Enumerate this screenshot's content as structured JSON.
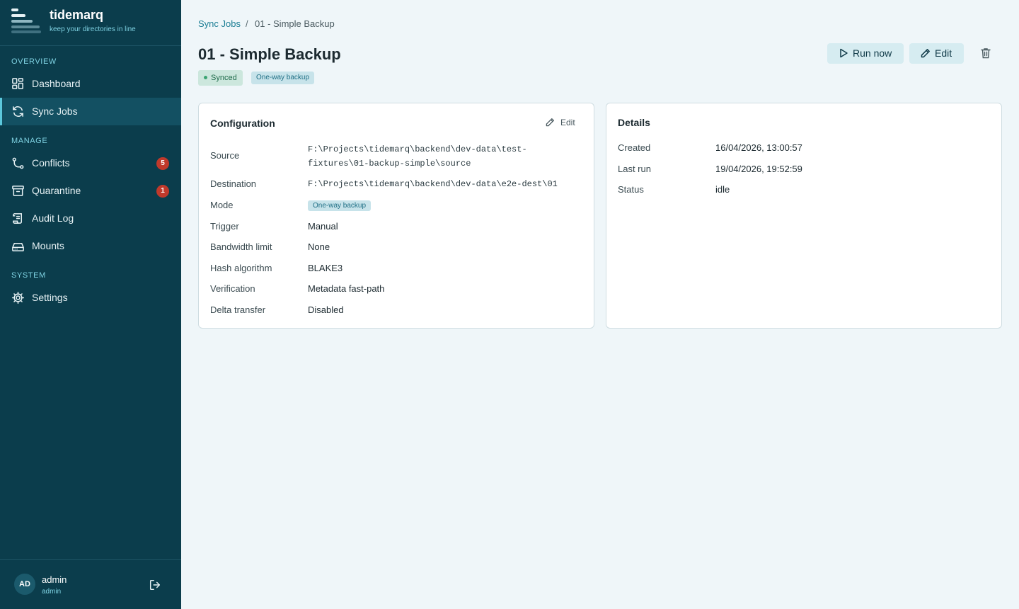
{
  "app": {
    "name": "tidemarq",
    "tagline": "keep your directories in line"
  },
  "sidebar": {
    "sections": {
      "overview": "OVERVIEW",
      "manage": "MANAGE",
      "system": "SYSTEM"
    },
    "items": [
      {
        "label": "Dashboard",
        "icon": "dashboard-icon"
      },
      {
        "label": "Sync Jobs",
        "icon": "sync-icon",
        "active": true
      },
      {
        "label": "Conflicts",
        "icon": "conflicts-icon",
        "badge": "5"
      },
      {
        "label": "Quarantine",
        "icon": "archive-icon",
        "badge": "1"
      },
      {
        "label": "Audit Log",
        "icon": "scroll-icon"
      },
      {
        "label": "Mounts",
        "icon": "drive-icon"
      },
      {
        "label": "Settings",
        "icon": "gear-icon"
      }
    ],
    "badge_color": "#c0392b"
  },
  "user": {
    "initials": "AD",
    "name": "admin",
    "role": "admin"
  },
  "breadcrumb": {
    "parent": "Sync Jobs",
    "separator": "/",
    "current": "01 - Simple Backup"
  },
  "page": {
    "title": "01 - Simple Backup",
    "status_tag": "Synced",
    "mode_tag": "One-way backup"
  },
  "actions": {
    "run_now": "Run now",
    "edit": "Edit"
  },
  "configuration": {
    "title": "Configuration",
    "edit_label": "Edit",
    "rows": [
      {
        "label": "Source",
        "value": "F:\\Projects\\tidemarq\\backend\\dev-data\\test-fixtures\\01-backup-simple\\source"
      },
      {
        "label": "Destination",
        "value": "F:\\Projects\\tidemarq\\backend\\dev-data\\e2e-dest\\01"
      },
      {
        "label": "Mode",
        "value": "One-way backup"
      },
      {
        "label": "Trigger",
        "value": "Manual"
      },
      {
        "label": "Bandwidth limit",
        "value": "None"
      },
      {
        "label": "Hash algorithm",
        "value": "BLAKE3"
      },
      {
        "label": "Verification",
        "value": "Metadata fast-path"
      },
      {
        "label": "Delta transfer",
        "value": "Disabled"
      }
    ]
  },
  "details": {
    "title": "Details",
    "rows": [
      {
        "label": "Created",
        "value": "16/04/2026, 13:00:57"
      },
      {
        "label": "Last run",
        "value": "19/04/2026, 19:52:59"
      },
      {
        "label": "Status",
        "value": "idle"
      }
    ]
  },
  "colors": {
    "sidebar_bg": "#0b3d4c",
    "accent": "#1a7d94",
    "page_bg": "#eff6f9"
  }
}
